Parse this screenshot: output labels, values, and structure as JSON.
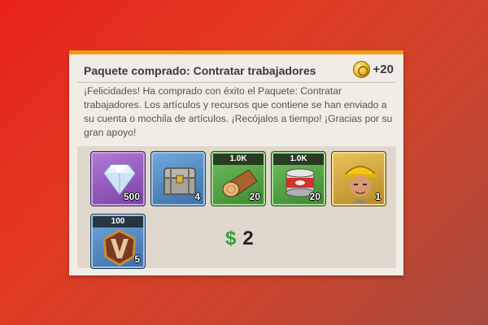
{
  "dialog": {
    "title": "Paquete comprado: Contratar trabajadores",
    "reward_amount": "+20",
    "reward_icon": "gold-coin-icon",
    "message": "¡Felicidades! Ha comprado con éxito el Paquete: Contratar trabajadores. Los artículos y recursos que contiene se han enviado a su cuenta o mochila de artículos. ¡Recójalos a tiempo! ¡Gracias por su gran apoyo!"
  },
  "items": [
    {
      "icon": "diamond-icon",
      "rarity": "purple",
      "quantity": "500",
      "tag": ""
    },
    {
      "icon": "treasure-chest-icon",
      "rarity": "blue",
      "quantity": "4",
      "tag": ""
    },
    {
      "icon": "wood-log-icon",
      "rarity": "green",
      "quantity": "20",
      "tag": "1.0K"
    },
    {
      "icon": "food-can-icon",
      "rarity": "green",
      "quantity": "20",
      "tag": "1.0K"
    },
    {
      "icon": "worker-portrait-icon",
      "rarity": "gold",
      "quantity": "1",
      "tag": ""
    },
    {
      "icon": "rank-badge-icon",
      "rarity": "blue",
      "quantity": "5",
      "tag": "100"
    }
  ],
  "price": {
    "currency": "$",
    "value": "2"
  },
  "colors": {
    "accent": "#f29a14",
    "price_currency": "#2fa23c",
    "card_bg": "#f1ece5"
  }
}
